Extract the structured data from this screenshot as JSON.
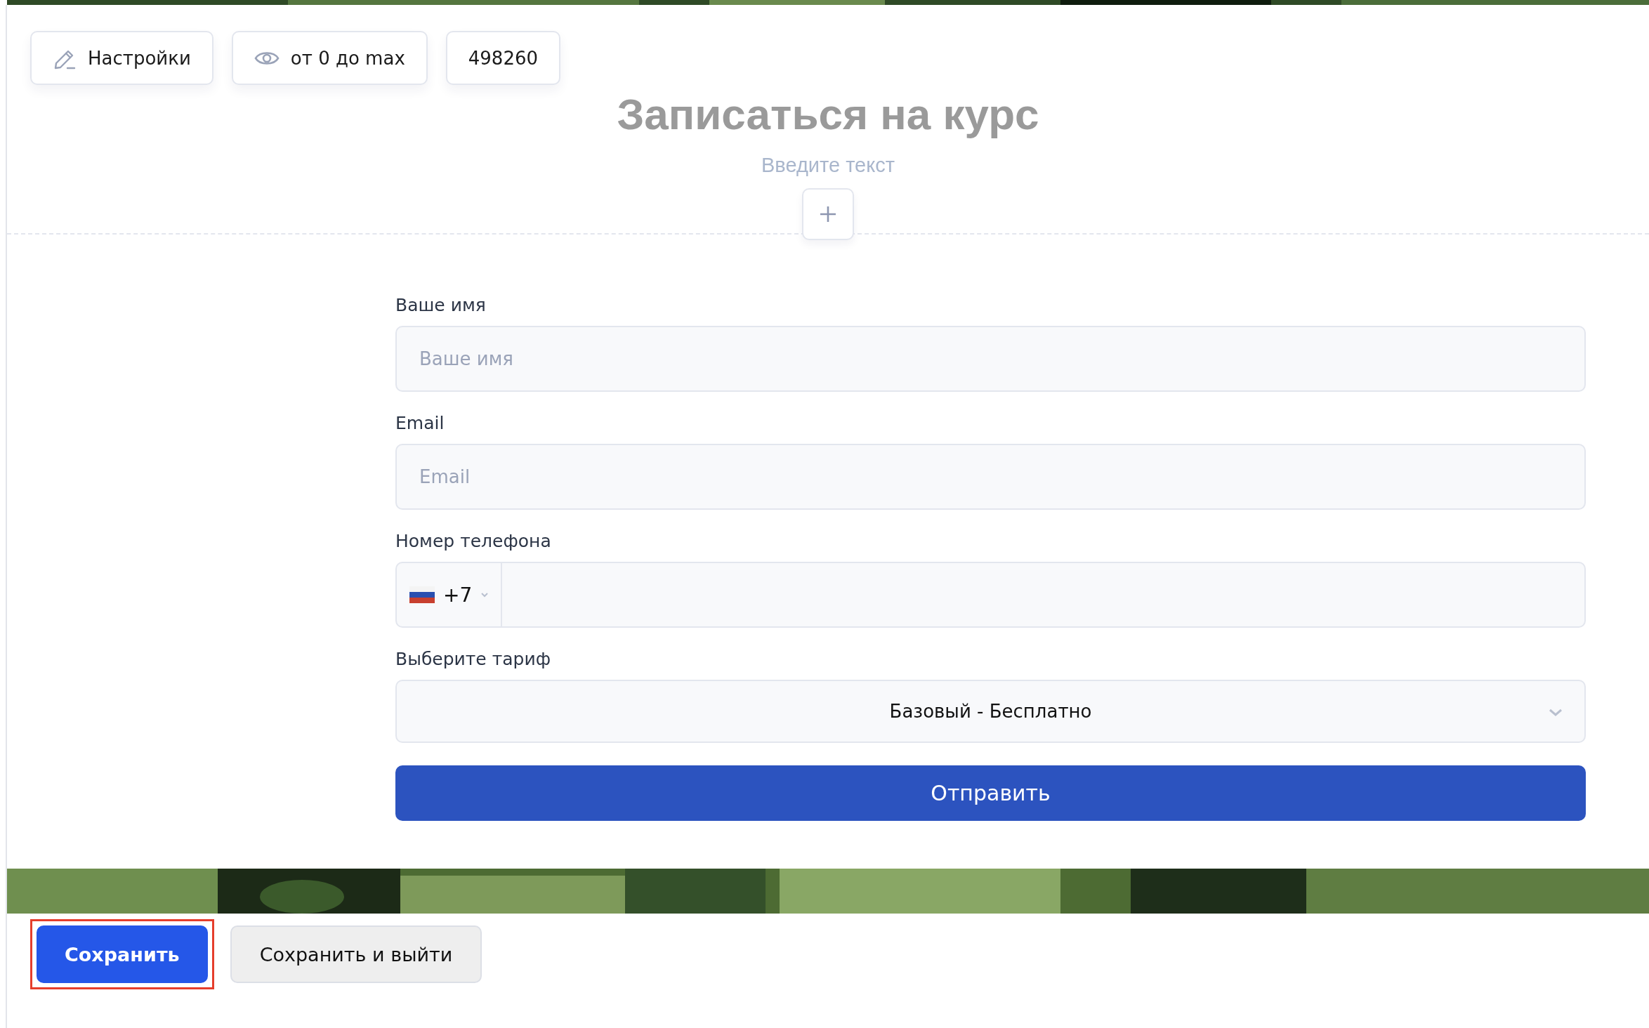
{
  "toolbar": [
    {
      "kind": "settings",
      "label": "Настройки"
    },
    {
      "kind": "visibility",
      "label": "от 0 до max"
    },
    {
      "kind": "plain",
      "label": "498260"
    }
  ],
  "header": {
    "title": "Записаться на курс",
    "subtitle_placeholder": "Введите текст"
  },
  "form": {
    "fields": [
      {
        "kind": "text",
        "label": "Ваше имя",
        "placeholder": "Ваше имя"
      },
      {
        "kind": "text",
        "label": "Email",
        "placeholder": "Email"
      },
      {
        "kind": "phone",
        "label": "Номер телефона",
        "code": "+7"
      },
      {
        "kind": "select",
        "label": "Выберите тариф",
        "value": "Базовый - Бесплатно"
      }
    ],
    "submit": "Отправить"
  },
  "footer_buttons": [
    {
      "label": "Сохранить",
      "primary": true,
      "highlighted": true
    },
    {
      "label": "Сохранить и выйти",
      "primary": false,
      "highlighted": false
    }
  ]
}
